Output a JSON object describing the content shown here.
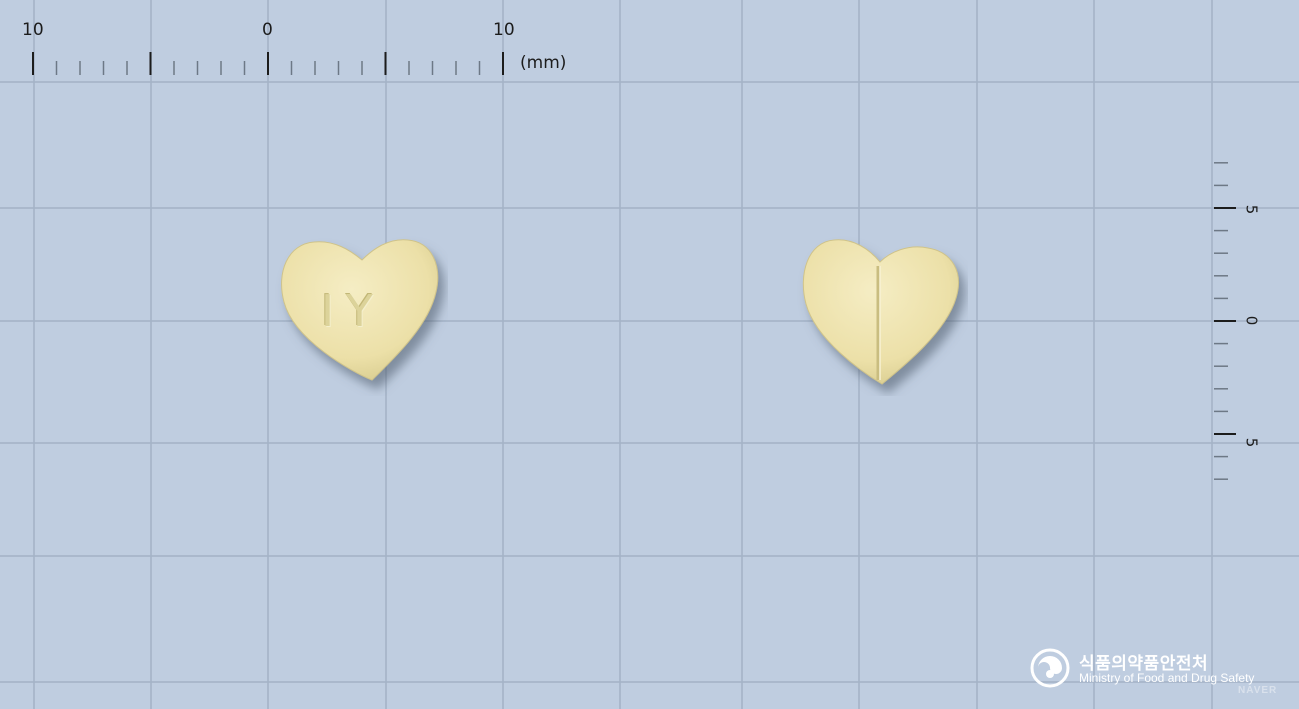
{
  "ruler_top": {
    "labels": [
      "10",
      "0",
      "10"
    ],
    "unit": "(mm)"
  },
  "ruler_right": {
    "labels": [
      "5",
      "0",
      "5"
    ]
  },
  "pills": {
    "front": {
      "shape": "heart",
      "color": "#efe4b0",
      "imprint": "IY"
    },
    "back": {
      "shape": "heart",
      "color": "#efe4b0",
      "score_line": true
    }
  },
  "watermark": {
    "agency_ko": "식품의약품안전처",
    "agency_en": "Ministry of Food and Drug Safety",
    "provider": "NAVER"
  },
  "colors": {
    "background": "#bfcde0",
    "grid_line": "#a3b2c6",
    "pill": "#efe4b0"
  }
}
